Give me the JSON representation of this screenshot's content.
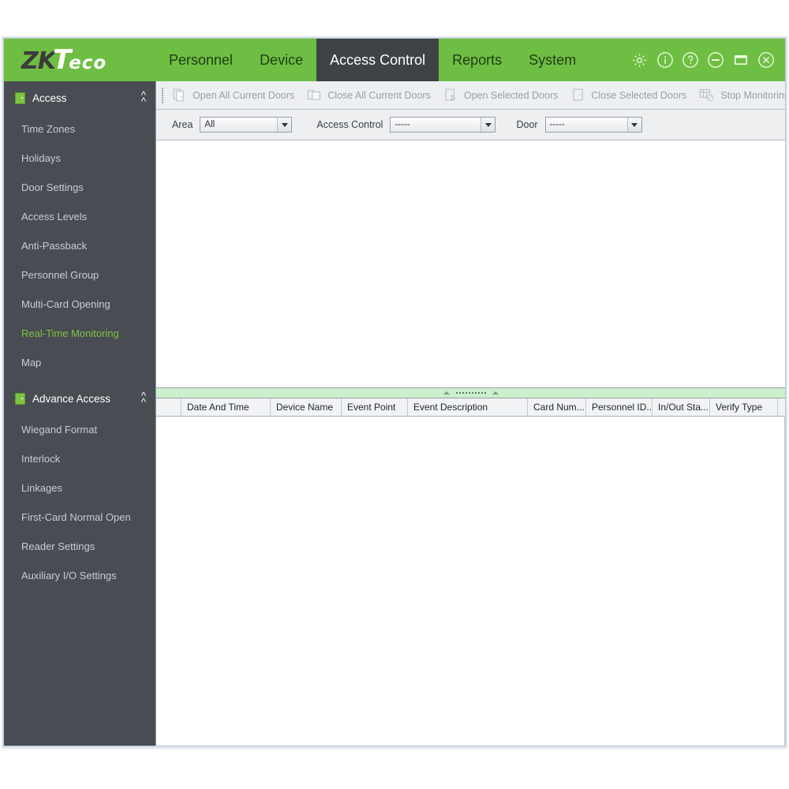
{
  "app": {
    "brand_primary": "ZK",
    "brand_t": "T",
    "brand_suffix": "eco",
    "green": "#6fbe44",
    "dark": "#3f4247",
    "sidebar_bg": "#494c52",
    "active_item_color": "#7dc242"
  },
  "mainnav": {
    "items": [
      {
        "label": "Personnel",
        "active": false
      },
      {
        "label": "Device",
        "active": false
      },
      {
        "label": "Access Control",
        "active": true
      },
      {
        "label": "Reports",
        "active": false
      },
      {
        "label": "System",
        "active": false
      }
    ]
  },
  "window_controls": [
    {
      "name": "settings-gear-icon",
      "glyph": "gear"
    },
    {
      "name": "info-icon",
      "glyph": "i"
    },
    {
      "name": "help-icon",
      "glyph": "?"
    },
    {
      "name": "minimize-icon",
      "glyph": "minus"
    },
    {
      "name": "maximize-icon",
      "glyph": "square"
    },
    {
      "name": "close-icon",
      "glyph": "x"
    }
  ],
  "sidebar": {
    "sections": [
      {
        "title": "Access",
        "icon": "door-icon",
        "collapse_icon": "chevron-up-icon",
        "items": [
          {
            "label": "Time Zones",
            "active": false
          },
          {
            "label": "Holidays",
            "active": false
          },
          {
            "label": "Door Settings",
            "active": false
          },
          {
            "label": "Access Levels",
            "active": false
          },
          {
            "label": "Anti-Passback",
            "active": false
          },
          {
            "label": "Personnel Group",
            "active": false
          },
          {
            "label": "Multi-Card Opening",
            "active": false
          },
          {
            "label": "Real-Time Monitoring",
            "active": true
          },
          {
            "label": "Map",
            "active": false
          }
        ]
      },
      {
        "title": "Advance Access",
        "icon": "advance-access-icon",
        "collapse_icon": "chevron-up-icon",
        "items": [
          {
            "label": "Wiegand Format",
            "active": false
          },
          {
            "label": "Interlock",
            "active": false
          },
          {
            "label": "Linkages",
            "active": false
          },
          {
            "label": "First-Card Normal Open",
            "active": false
          },
          {
            "label": "Reader Settings",
            "active": false
          },
          {
            "label": "Auxiliary I/O Settings",
            "active": false
          }
        ]
      }
    ]
  },
  "toolbar": {
    "buttons": [
      {
        "label": "Open All Current Doors",
        "icon": "open-doors-icon",
        "disabled": true
      },
      {
        "label": "Close All Current Doors",
        "icon": "close-doors-icon",
        "disabled": true
      },
      {
        "label": "Open Selected Doors",
        "icon": "open-selected-door-icon",
        "disabled": true
      },
      {
        "label": "Close Selected Doors",
        "icon": "close-selected-door-icon",
        "disabled": true
      },
      {
        "label": "Stop Monitoring",
        "icon": "stop-monitoring-icon",
        "disabled": true
      }
    ]
  },
  "filters": [
    {
      "label": "Area",
      "value": "All",
      "name": "area-select"
    },
    {
      "label": "Access Control",
      "value": "-----",
      "name": "access-control-select"
    },
    {
      "label": "Door",
      "value": "-----",
      "name": "door-select"
    }
  ],
  "grid": {
    "columns": [
      {
        "label": "",
        "width": 32
      },
      {
        "label": "Date And Time",
        "width": 113
      },
      {
        "label": "Device Name",
        "width": 90
      },
      {
        "label": "Event Point",
        "width": 84
      },
      {
        "label": "Event Description",
        "width": 152
      },
      {
        "label": "Card Num...",
        "width": 74
      },
      {
        "label": "Personnel ID...",
        "width": 84
      },
      {
        "label": "In/Out Sta...",
        "width": 73
      },
      {
        "label": "Verify Type",
        "width": 86
      }
    ],
    "rows": []
  }
}
